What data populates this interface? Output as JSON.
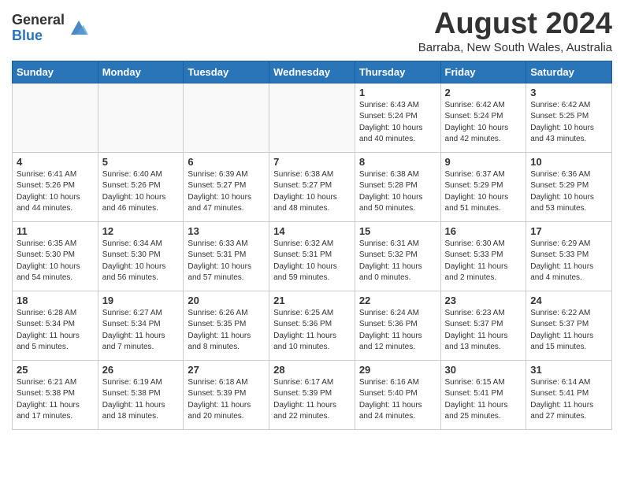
{
  "header": {
    "logo_general": "General",
    "logo_blue": "Blue",
    "month_year": "August 2024",
    "location": "Barraba, New South Wales, Australia"
  },
  "days_of_week": [
    "Sunday",
    "Monday",
    "Tuesday",
    "Wednesday",
    "Thursday",
    "Friday",
    "Saturday"
  ],
  "weeks": [
    [
      {
        "day": "",
        "info": ""
      },
      {
        "day": "",
        "info": ""
      },
      {
        "day": "",
        "info": ""
      },
      {
        "day": "",
        "info": ""
      },
      {
        "day": "1",
        "info": "Sunrise: 6:43 AM\nSunset: 5:24 PM\nDaylight: 10 hours\nand 40 minutes."
      },
      {
        "day": "2",
        "info": "Sunrise: 6:42 AM\nSunset: 5:24 PM\nDaylight: 10 hours\nand 42 minutes."
      },
      {
        "day": "3",
        "info": "Sunrise: 6:42 AM\nSunset: 5:25 PM\nDaylight: 10 hours\nand 43 minutes."
      }
    ],
    [
      {
        "day": "4",
        "info": "Sunrise: 6:41 AM\nSunset: 5:26 PM\nDaylight: 10 hours\nand 44 minutes."
      },
      {
        "day": "5",
        "info": "Sunrise: 6:40 AM\nSunset: 5:26 PM\nDaylight: 10 hours\nand 46 minutes."
      },
      {
        "day": "6",
        "info": "Sunrise: 6:39 AM\nSunset: 5:27 PM\nDaylight: 10 hours\nand 47 minutes."
      },
      {
        "day": "7",
        "info": "Sunrise: 6:38 AM\nSunset: 5:27 PM\nDaylight: 10 hours\nand 48 minutes."
      },
      {
        "day": "8",
        "info": "Sunrise: 6:38 AM\nSunset: 5:28 PM\nDaylight: 10 hours\nand 50 minutes."
      },
      {
        "day": "9",
        "info": "Sunrise: 6:37 AM\nSunset: 5:29 PM\nDaylight: 10 hours\nand 51 minutes."
      },
      {
        "day": "10",
        "info": "Sunrise: 6:36 AM\nSunset: 5:29 PM\nDaylight: 10 hours\nand 53 minutes."
      }
    ],
    [
      {
        "day": "11",
        "info": "Sunrise: 6:35 AM\nSunset: 5:30 PM\nDaylight: 10 hours\nand 54 minutes."
      },
      {
        "day": "12",
        "info": "Sunrise: 6:34 AM\nSunset: 5:30 PM\nDaylight: 10 hours\nand 56 minutes."
      },
      {
        "day": "13",
        "info": "Sunrise: 6:33 AM\nSunset: 5:31 PM\nDaylight: 10 hours\nand 57 minutes."
      },
      {
        "day": "14",
        "info": "Sunrise: 6:32 AM\nSunset: 5:31 PM\nDaylight: 10 hours\nand 59 minutes."
      },
      {
        "day": "15",
        "info": "Sunrise: 6:31 AM\nSunset: 5:32 PM\nDaylight: 11 hours\nand 0 minutes."
      },
      {
        "day": "16",
        "info": "Sunrise: 6:30 AM\nSunset: 5:33 PM\nDaylight: 11 hours\nand 2 minutes."
      },
      {
        "day": "17",
        "info": "Sunrise: 6:29 AM\nSunset: 5:33 PM\nDaylight: 11 hours\nand 4 minutes."
      }
    ],
    [
      {
        "day": "18",
        "info": "Sunrise: 6:28 AM\nSunset: 5:34 PM\nDaylight: 11 hours\nand 5 minutes."
      },
      {
        "day": "19",
        "info": "Sunrise: 6:27 AM\nSunset: 5:34 PM\nDaylight: 11 hours\nand 7 minutes."
      },
      {
        "day": "20",
        "info": "Sunrise: 6:26 AM\nSunset: 5:35 PM\nDaylight: 11 hours\nand 8 minutes."
      },
      {
        "day": "21",
        "info": "Sunrise: 6:25 AM\nSunset: 5:36 PM\nDaylight: 11 hours\nand 10 minutes."
      },
      {
        "day": "22",
        "info": "Sunrise: 6:24 AM\nSunset: 5:36 PM\nDaylight: 11 hours\nand 12 minutes."
      },
      {
        "day": "23",
        "info": "Sunrise: 6:23 AM\nSunset: 5:37 PM\nDaylight: 11 hours\nand 13 minutes."
      },
      {
        "day": "24",
        "info": "Sunrise: 6:22 AM\nSunset: 5:37 PM\nDaylight: 11 hours\nand 15 minutes."
      }
    ],
    [
      {
        "day": "25",
        "info": "Sunrise: 6:21 AM\nSunset: 5:38 PM\nDaylight: 11 hours\nand 17 minutes."
      },
      {
        "day": "26",
        "info": "Sunrise: 6:19 AM\nSunset: 5:38 PM\nDaylight: 11 hours\nand 18 minutes."
      },
      {
        "day": "27",
        "info": "Sunrise: 6:18 AM\nSunset: 5:39 PM\nDaylight: 11 hours\nand 20 minutes."
      },
      {
        "day": "28",
        "info": "Sunrise: 6:17 AM\nSunset: 5:39 PM\nDaylight: 11 hours\nand 22 minutes."
      },
      {
        "day": "29",
        "info": "Sunrise: 6:16 AM\nSunset: 5:40 PM\nDaylight: 11 hours\nand 24 minutes."
      },
      {
        "day": "30",
        "info": "Sunrise: 6:15 AM\nSunset: 5:41 PM\nDaylight: 11 hours\nand 25 minutes."
      },
      {
        "day": "31",
        "info": "Sunrise: 6:14 AM\nSunset: 5:41 PM\nDaylight: 11 hours\nand 27 minutes."
      }
    ]
  ]
}
